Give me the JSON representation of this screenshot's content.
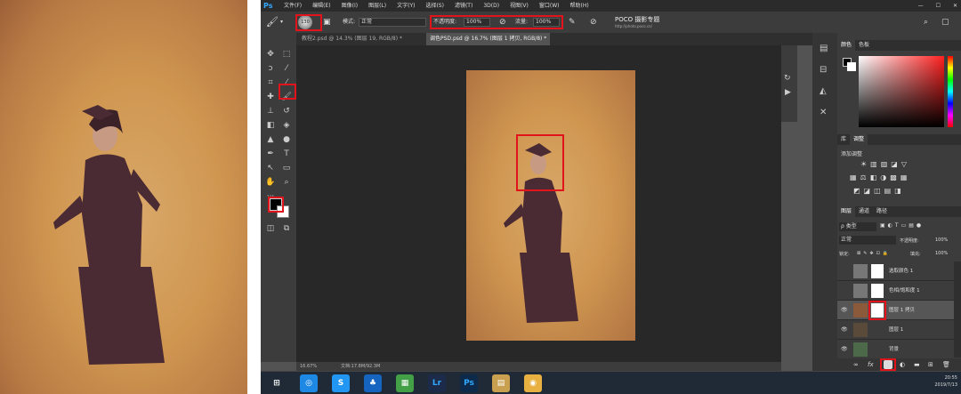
{
  "app": {
    "logo": "Ps",
    "menu": [
      "文件(F)",
      "编辑(E)",
      "图像(I)",
      "图层(L)",
      "文字(Y)",
      "选择(S)",
      "滤镜(T)",
      "3D(D)",
      "视图(V)",
      "窗口(W)",
      "帮助(H)"
    ],
    "window_controls": [
      "—",
      "☐",
      "✕"
    ]
  },
  "options": {
    "brush_size": "130",
    "mode_label": "模式:",
    "mode_value": "正常",
    "opacity_label": "不透明度:",
    "opacity_value": "100%",
    "flow_label": "流量:",
    "flow_value": "100%",
    "watermark": "POCO 摄影专题",
    "watermark_url": "http://photo.poco.cn/"
  },
  "tabs": [
    {
      "label": "教程2.psd @ 14.3% (图层 19, RGB/8) *",
      "active": false
    },
    {
      "label": "调色PSD.psd @ 16.7% (图层 1 拷贝, RGB/8) *",
      "active": true
    }
  ],
  "status": {
    "zoom": "16.67%",
    "doc": "文档:17.8M/92.3M"
  },
  "panels": {
    "color_tabs": [
      "颜色",
      "色板"
    ],
    "lib_tabs": [
      "库",
      "调整"
    ],
    "adjust_title": "添加调整",
    "layers_tabs": [
      "图层",
      "通道",
      "路径"
    ],
    "kind_label": "ρ 类型",
    "blend_mode": "正常",
    "opacity_label": "不透明度:",
    "opacity_value": "100%",
    "lock_label": "锁定:",
    "fill_label": "填充:",
    "fill_value": "100%",
    "layers": [
      {
        "name": "选取颜色 1",
        "selected": false
      },
      {
        "name": "色相/饱和度 1",
        "selected": false
      },
      {
        "name": "图层 1 拷贝",
        "selected": true
      },
      {
        "name": "图层 1",
        "selected": false
      },
      {
        "name": "背景",
        "selected": false
      }
    ]
  },
  "taskbar": {
    "apps": [
      "⊞",
      "◎",
      "S",
      "♣",
      "▦",
      "Lr",
      "Ps",
      "▤",
      "◉"
    ],
    "time": "20:55",
    "date": "2019/7/13"
  },
  "colors": {
    "accent": "#e0141a",
    "ps_blue": "#31a8ff",
    "dress": "#4a2a33"
  }
}
